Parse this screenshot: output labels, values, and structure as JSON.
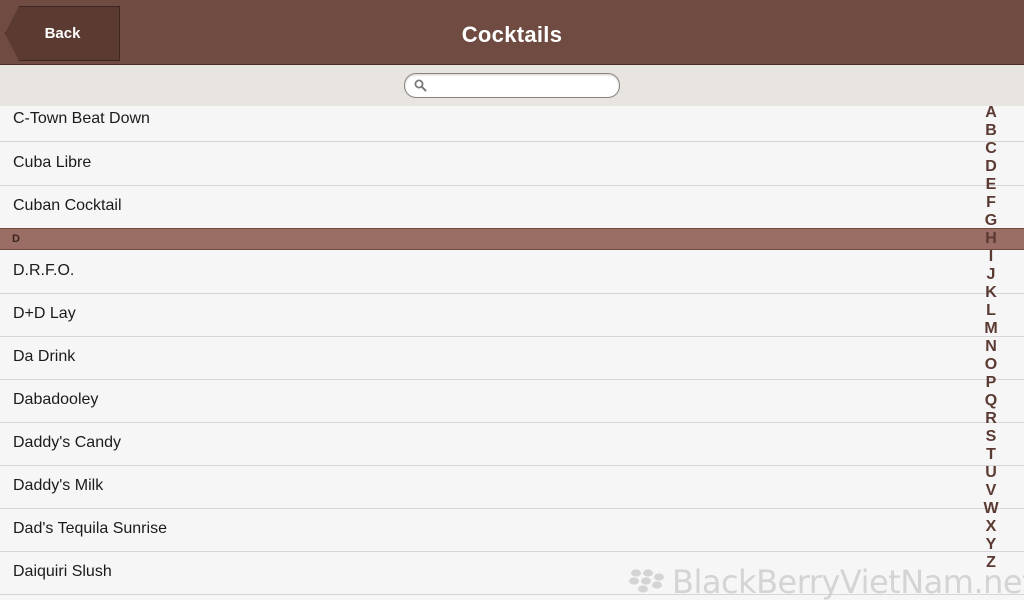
{
  "header": {
    "title": "Cocktails",
    "back_label": "Back",
    "background_color": "#6f4b42"
  },
  "search": {
    "value": "",
    "placeholder": "",
    "icon": "search-icon"
  },
  "list": {
    "items": [
      {
        "type": "item",
        "label": "C-Town Beat Down"
      },
      {
        "type": "item",
        "label": "Cuba Libre"
      },
      {
        "type": "item",
        "label": "Cuban Cocktail"
      },
      {
        "type": "section",
        "label": "D"
      },
      {
        "type": "item",
        "label": "D.R.F.O."
      },
      {
        "type": "item",
        "label": "D+D Lay"
      },
      {
        "type": "item",
        "label": "Da Drink"
      },
      {
        "type": "item",
        "label": "Dabadooley"
      },
      {
        "type": "item",
        "label": "Daddy's Candy"
      },
      {
        "type": "item",
        "label": "Daddy's Milk"
      },
      {
        "type": "item",
        "label": "Dad's Tequila Sunrise"
      },
      {
        "type": "item",
        "label": "Daiquiri Slush"
      }
    ],
    "section_color": "#9a6e64"
  },
  "index_bar": {
    "letters": [
      "A",
      "B",
      "C",
      "D",
      "E",
      "F",
      "G",
      "H",
      "I",
      "J",
      "K",
      "L",
      "M",
      "N",
      "O",
      "P",
      "Q",
      "R",
      "S",
      "T",
      "U",
      "V",
      "W",
      "X",
      "Y",
      "Z"
    ],
    "color": "#5b3a33"
  },
  "watermark": {
    "text": "BlackBerryVietNam.net",
    "icon": "blackberry-logo-icon"
  }
}
